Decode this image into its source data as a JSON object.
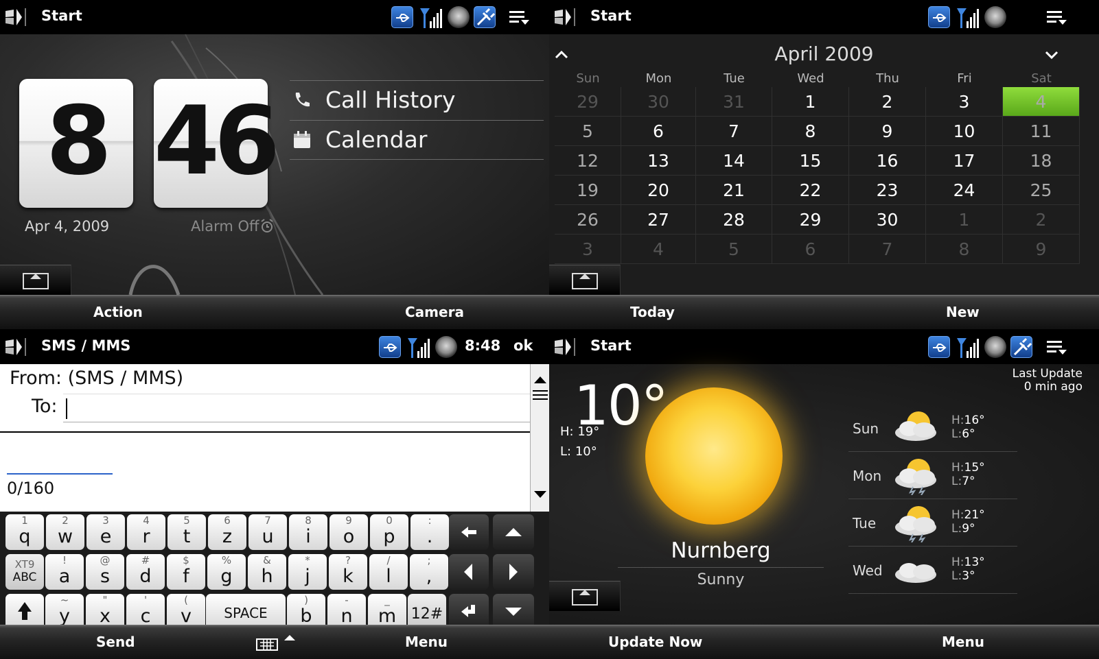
{
  "home": {
    "title": "Start",
    "hour": "8",
    "minute": "46",
    "date": "Apr 4, 2009",
    "alarm": "Alarm Off",
    "links": [
      "Call History",
      "Calendar"
    ],
    "soft_left": "Action",
    "soft_right": "Camera"
  },
  "calendar": {
    "title": "Start",
    "month": "April 2009",
    "days_of_week": [
      "Sun",
      "Mon",
      "Tue",
      "Wed",
      "Thu",
      "Fri",
      "Sat"
    ],
    "weeks": [
      [
        "29",
        "30",
        "31",
        "1",
        "2",
        "3",
        "4"
      ],
      [
        "5",
        "6",
        "7",
        "8",
        "9",
        "10",
        "11"
      ],
      [
        "12",
        "13",
        "14",
        "15",
        "16",
        "17",
        "18"
      ],
      [
        "19",
        "20",
        "21",
        "22",
        "23",
        "24",
        "25"
      ],
      [
        "26",
        "27",
        "28",
        "29",
        "30",
        "1",
        "2"
      ],
      [
        "3",
        "4",
        "5",
        "6",
        "7",
        "8",
        "9"
      ]
    ],
    "selected": "4",
    "selected_color": "#6cc22a",
    "soft_left": "Today",
    "soft_right": "New"
  },
  "sms": {
    "title": "SMS / MMS",
    "time": "8:48",
    "ok_label": "ok",
    "from_label": "From: (SMS / MMS)",
    "to_label": "To:",
    "char_count": "0/160",
    "soft_left": "Send",
    "soft_right": "Menu",
    "keyboard": {
      "row1": [
        [
          "1",
          "q"
        ],
        [
          "2",
          "w"
        ],
        [
          "3",
          "e"
        ],
        [
          "4",
          "r"
        ],
        [
          "5",
          "t"
        ],
        [
          "6",
          "z"
        ],
        [
          "7",
          "u"
        ],
        [
          "8",
          "i"
        ],
        [
          "9",
          "o"
        ],
        [
          "0",
          "p"
        ],
        [
          ":",
          "."
        ]
      ],
      "row2": [
        [
          "!",
          "a"
        ],
        [
          "@",
          "s"
        ],
        [
          "#",
          "d"
        ],
        [
          "$",
          "f"
        ],
        [
          "%",
          "g"
        ],
        [
          "&",
          "h"
        ],
        [
          "*",
          "j"
        ],
        [
          "?",
          "k"
        ],
        [
          "/",
          "l"
        ],
        [
          ";",
          ","
        ]
      ],
      "row3": [
        [
          "~",
          "y"
        ],
        [
          "\"",
          "x"
        ],
        [
          "'",
          "c"
        ],
        [
          "(",
          "v"
        ],
        [
          ")",
          "b"
        ],
        [
          "-",
          "n"
        ],
        [
          "_",
          "m"
        ]
      ],
      "xt9_top": "XT9",
      "xt9_bottom": "ABC",
      "space_label": "SPACE",
      "num_label": "12#"
    }
  },
  "weather": {
    "title": "Start",
    "temp": "10°",
    "high": "H: 19°",
    "low": "L: 10°",
    "city": "Nurnberg",
    "condition": "Sunny",
    "last_update_line1": "Last Update",
    "last_update_line2": "0 min ago",
    "forecast": [
      {
        "day": "Sun",
        "high": "16°",
        "low": "6°",
        "icon": "partly-cloudy-icon"
      },
      {
        "day": "Mon",
        "high": "15°",
        "low": "7°",
        "icon": "thunderstorm-icon"
      },
      {
        "day": "Tue",
        "high": "21°",
        "low": "9°",
        "icon": "thunderstorm-icon"
      },
      {
        "day": "Wed",
        "high": "13°",
        "low": "3°",
        "icon": "cloudy-icon"
      }
    ],
    "soft_left": "Update Now",
    "soft_right": "Menu"
  }
}
